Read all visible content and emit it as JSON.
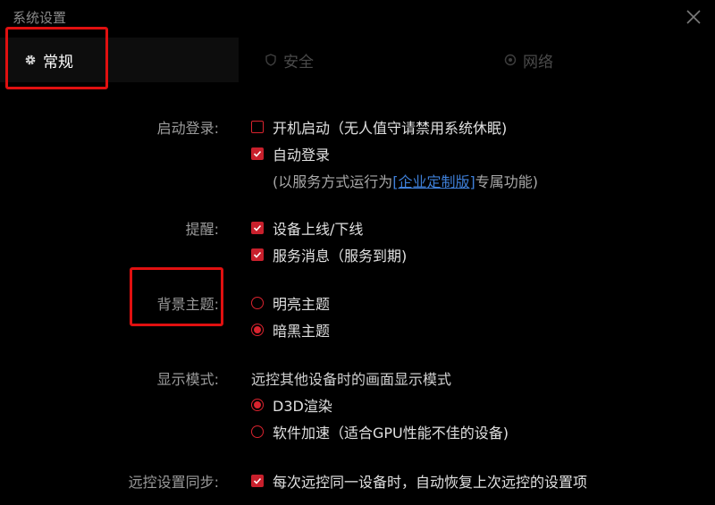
{
  "window": {
    "title": "系统设置",
    "close_icon": "close-icon"
  },
  "tabs": [
    {
      "label": "常规",
      "icon": "gear-icon",
      "active": true
    },
    {
      "label": "安全",
      "icon": "shield-icon",
      "active": false
    },
    {
      "label": "网络",
      "icon": "network-icon",
      "active": false
    }
  ],
  "sections": {
    "startup": {
      "label": "启动登录:",
      "options": [
        {
          "label": "开机启动（无人值守请禁用系统休眠)",
          "checked": false
        },
        {
          "label": "自动登录",
          "checked": true
        }
      ],
      "note_prefix": "(以服务方式运行为",
      "note_link": "[企业定制版]",
      "note_suffix": "专属功能)"
    },
    "reminder": {
      "label": "提醒:",
      "options": [
        {
          "label": "设备上线/下线",
          "checked": true
        },
        {
          "label": "服务消息（服务到期)",
          "checked": true
        }
      ]
    },
    "theme": {
      "label": "背景主题:",
      "options": [
        {
          "label": "明亮主题",
          "selected": false
        },
        {
          "label": "暗黑主题",
          "selected": true
        }
      ]
    },
    "display": {
      "label": "显示模式:",
      "description": "远控其他设备时的画面显示模式",
      "options": [
        {
          "label": "D3D渲染",
          "selected": true
        },
        {
          "label": "软件加速（适合GPU性能不佳的设备)",
          "selected": false
        }
      ]
    },
    "sync": {
      "label": "远控设置同步:",
      "options": [
        {
          "label": "每次远控同一设备时，自动恢复上次远控的设置项",
          "checked": true
        }
      ]
    }
  },
  "colors": {
    "accent": "#d9232e",
    "highlight_box": "#e01010",
    "link": "#3e7fd8",
    "background": "#000000"
  }
}
